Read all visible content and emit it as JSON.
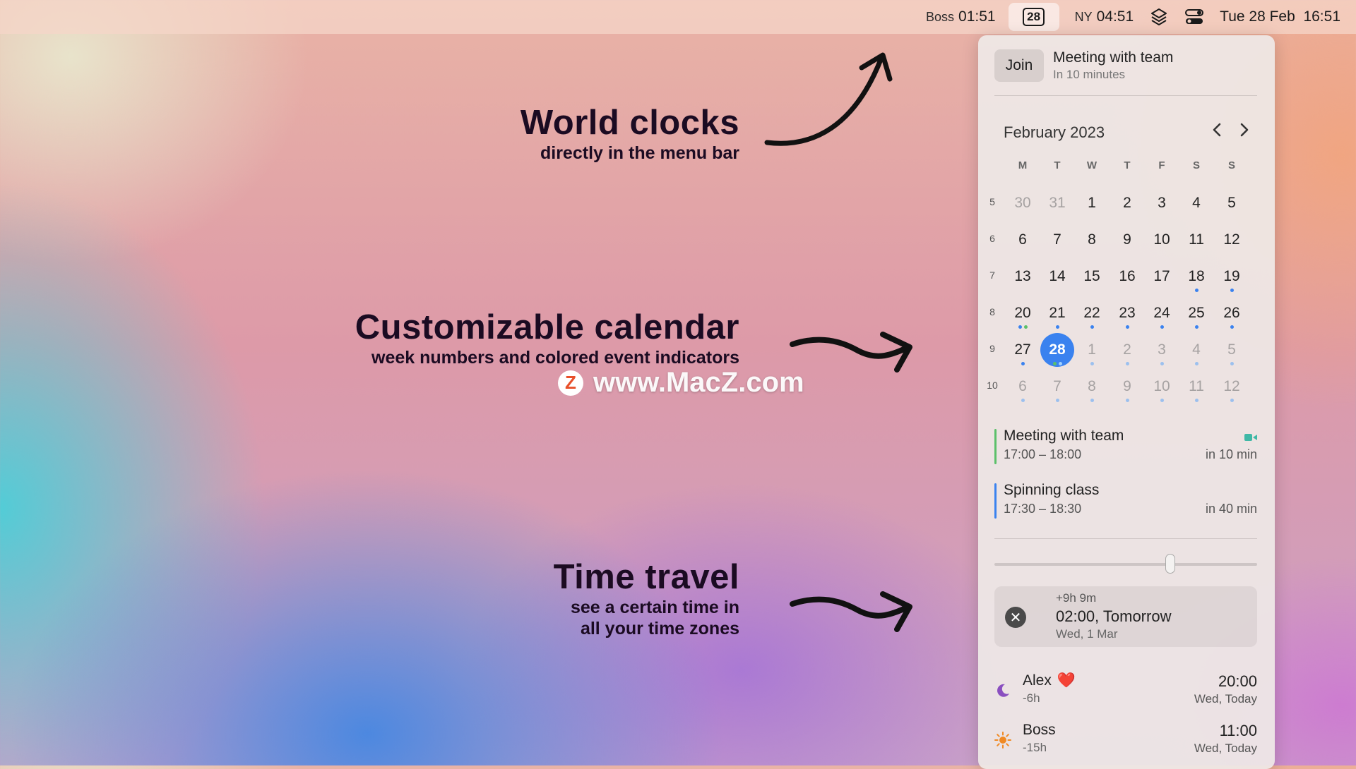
{
  "menubar": {
    "clock1_label": "Boss",
    "clock1_time": "01:51",
    "calendar_day": "28",
    "clock2_label": "NY",
    "clock2_time": "04:51",
    "datetime": "Tue 28 Feb  16:51"
  },
  "annotations": {
    "world_clocks": {
      "title": "World clocks",
      "subtitle": "directly in the menu bar"
    },
    "calendar": {
      "title": "Customizable calendar",
      "subtitle": "week numbers and colored event indicators"
    },
    "time_travel": {
      "title": "Time travel",
      "subtitle_line1": "see a certain time in",
      "subtitle_line2": "all your time zones"
    }
  },
  "watermark": {
    "logo": "Z",
    "text": "www.MacZ.com"
  },
  "panel": {
    "upcoming": {
      "join_label": "Join",
      "title": "Meeting with team",
      "subtitle": "In 10 minutes"
    },
    "calendar": {
      "month": "February 2023",
      "weekdays": [
        "M",
        "T",
        "W",
        "T",
        "F",
        "S",
        "S"
      ],
      "weeks": [
        {
          "num": "5",
          "days": [
            {
              "d": "30",
              "muted": true,
              "dots": []
            },
            {
              "d": "31",
              "muted": true,
              "dots": []
            },
            {
              "d": "1",
              "dots": []
            },
            {
              "d": "2",
              "dots": []
            },
            {
              "d": "3",
              "dots": []
            },
            {
              "d": "4",
              "dots": []
            },
            {
              "d": "5",
              "dots": []
            }
          ]
        },
        {
          "num": "6",
          "days": [
            {
              "d": "6",
              "dots": []
            },
            {
              "d": "7",
              "dots": []
            },
            {
              "d": "8",
              "dots": []
            },
            {
              "d": "9",
              "dots": []
            },
            {
              "d": "10",
              "dots": []
            },
            {
              "d": "11",
              "dots": []
            },
            {
              "d": "12",
              "dots": []
            }
          ]
        },
        {
          "num": "7",
          "days": [
            {
              "d": "13",
              "dots": []
            },
            {
              "d": "14",
              "dots": []
            },
            {
              "d": "15",
              "dots": []
            },
            {
              "d": "16",
              "dots": []
            },
            {
              "d": "17",
              "dots": []
            },
            {
              "d": "18",
              "dots": [
                "#3a82ef"
              ]
            },
            {
              "d": "19",
              "dots": [
                "#3a82ef"
              ]
            }
          ]
        },
        {
          "num": "8",
          "days": [
            {
              "d": "20",
              "dots": [
                "#3a82ef",
                "#5cc06a"
              ]
            },
            {
              "d": "21",
              "dots": [
                "#3a82ef"
              ]
            },
            {
              "d": "22",
              "dots": [
                "#3a82ef"
              ]
            },
            {
              "d": "23",
              "dots": [
                "#3a82ef"
              ]
            },
            {
              "d": "24",
              "dots": [
                "#3a82ef"
              ]
            },
            {
              "d": "25",
              "dots": [
                "#3a82ef"
              ]
            },
            {
              "d": "26",
              "dots": [
                "#3a82ef"
              ]
            }
          ]
        },
        {
          "num": "9",
          "days": [
            {
              "d": "27",
              "dots": [
                "#3a82ef"
              ]
            },
            {
              "d": "28",
              "today": true,
              "dots": [
                "#5cc06a",
                "#9fd0ff"
              ]
            },
            {
              "d": "1",
              "muted": true,
              "dots": [
                "#9cc0ee"
              ]
            },
            {
              "d": "2",
              "muted": true,
              "dots": [
                "#9cc0ee"
              ]
            },
            {
              "d": "3",
              "muted": true,
              "dots": [
                "#9cc0ee"
              ]
            },
            {
              "d": "4",
              "muted": true,
              "dots": [
                "#9cc0ee"
              ]
            },
            {
              "d": "5",
              "muted": true,
              "dots": [
                "#9cc0ee"
              ]
            }
          ]
        },
        {
          "num": "10",
          "days": [
            {
              "d": "6",
              "muted": true,
              "dots": [
                "#9cc0ee"
              ]
            },
            {
              "d": "7",
              "muted": true,
              "dots": [
                "#9cc0ee"
              ]
            },
            {
              "d": "8",
              "muted": true,
              "dots": [
                "#9cc0ee"
              ]
            },
            {
              "d": "9",
              "muted": true,
              "dots": [
                "#9cc0ee"
              ]
            },
            {
              "d": "10",
              "muted": true,
              "dots": [
                "#9cc0ee"
              ]
            },
            {
              "d": "11",
              "muted": true,
              "dots": [
                "#9cc0ee"
              ]
            },
            {
              "d": "12",
              "muted": true,
              "dots": [
                "#9cc0ee"
              ]
            }
          ]
        }
      ]
    },
    "events": [
      {
        "title": "Meeting with team",
        "time": "17:00 – 18:00",
        "relative": "in 10 min",
        "color": "#5cc06a",
        "icon": "video-camera-icon"
      },
      {
        "title": "Spinning class",
        "time": "17:30 – 18:30",
        "relative": "in 40 min",
        "color": "#3a82ef"
      }
    ],
    "slider": {
      "value": 0.67
    },
    "time_travel": {
      "offset": "+9h 9m",
      "time": "02:00, Tomorrow",
      "date": "Wed, 1 Mar"
    },
    "zones": [
      {
        "name": "Alex",
        "emoji": "❤️",
        "offset": "-6h",
        "time": "20:00",
        "day": "Wed, Today",
        "icon": "moon-icon",
        "icon_color": "#8a4fc0"
      },
      {
        "name": "Boss",
        "offset": "-15h",
        "time": "11:00",
        "day": "Wed, Today",
        "icon": "sun-icon",
        "icon_color": "#f08a24"
      }
    ]
  }
}
